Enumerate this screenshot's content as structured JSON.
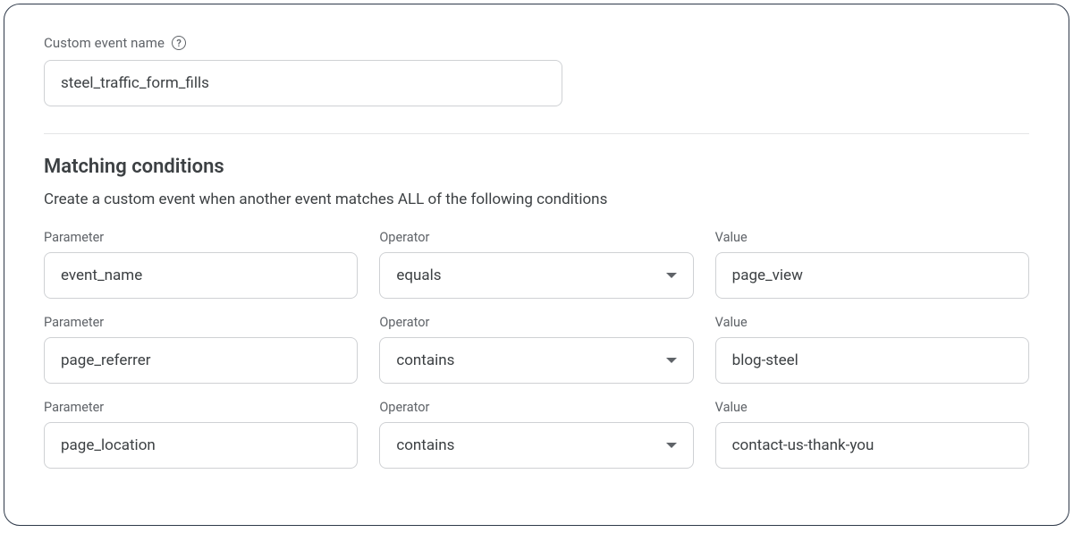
{
  "eventName": {
    "label": "Custom event name",
    "value": "steel_traffic_form_fills"
  },
  "matching": {
    "title": "Matching conditions",
    "description": "Create a custom event when another event matches ALL of the following conditions"
  },
  "columns": {
    "parameter": "Parameter",
    "operator": "Operator",
    "value": "Value"
  },
  "conditions": [
    {
      "parameter": "event_name",
      "operator": "equals",
      "value": "page_view"
    },
    {
      "parameter": "page_referrer",
      "operator": "contains",
      "value": "blog-steel"
    },
    {
      "parameter": "page_location",
      "operator": "contains",
      "value": "contact-us-thank-you"
    }
  ]
}
